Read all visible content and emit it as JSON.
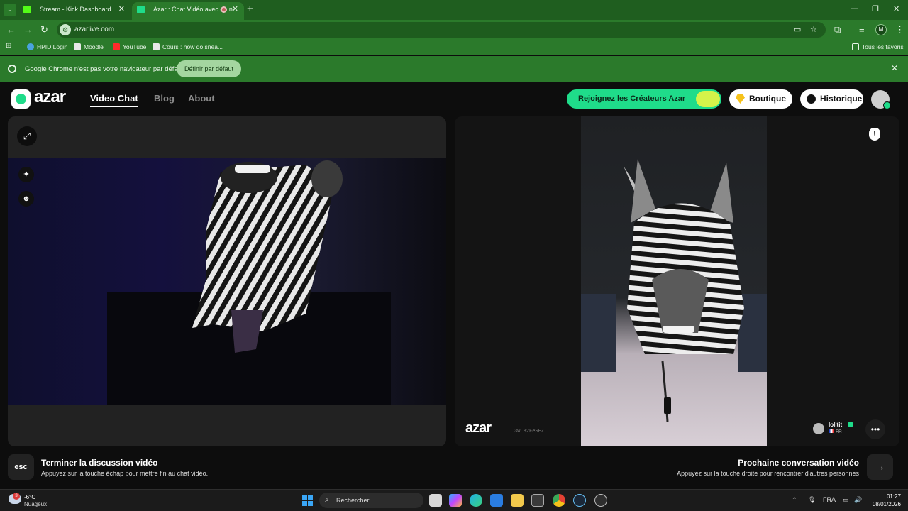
{
  "browser": {
    "tabs": [
      {
        "label": "Stream - Kick Dashboard",
        "favicon_color": "#53fc18"
      },
      {
        "label": "Azar : Chat Vidéo avec de n",
        "favicon_color": "#1fdc8a"
      }
    ],
    "url": "azarlive.com",
    "profile_initial": "M",
    "bookmarks": [
      {
        "label": "HPID Login",
        "icon_color": "#4aa3df"
      },
      {
        "label": "Moodle",
        "icon_color": "#e8e8e8"
      },
      {
        "label": "YouTube",
        "icon_color": "#ff2a2a"
      },
      {
        "label": "Cours : how do snea...",
        "icon_color": "#e8e8e8"
      }
    ],
    "all_bookmarks": "Tous les favoris",
    "infobar": {
      "message": "Google Chrome n'est pas votre navigateur par défaut",
      "button": "Définir par défaut"
    }
  },
  "azar": {
    "logo": "azar",
    "nav": [
      "Video Chat",
      "Blog",
      "About"
    ],
    "creators_button": "Rejoignez les Créateurs Azar",
    "shop_button": "Boutique",
    "history_button": "Historique",
    "watermark_logo": "azar",
    "watermark_id": "3WL82FeSEZ",
    "peer": {
      "name": "lolitit",
      "country": "FR"
    },
    "end_call": {
      "key": "esc",
      "title": "Terminer la discussion vidéo",
      "subtitle": "Appuyez sur la touche échap pour mettre fin au chat vidéo."
    },
    "next_call": {
      "title": "Prochaine conversation vidéo",
      "subtitle": "Appuyez sur la touche droite pour rencontrer d'autres personnes"
    },
    "accent_color": "#1fdc8a"
  },
  "taskbar": {
    "weather_badge": "3",
    "temperature": "-6°C",
    "weather": "Nuageux",
    "search_placeholder": "Rechercher",
    "language": "FRA",
    "time": "01:27",
    "date": "08/01/2026"
  }
}
